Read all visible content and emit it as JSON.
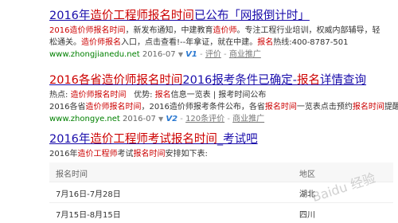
{
  "results": [
    {
      "title": [
        "2016年",
        "造价工程师报名时间",
        "已公布「网报倒计时」"
      ],
      "desc1": [
        "2016造价师报名时间",
        "，新发布通知，中建教育",
        "造价师",
        "。专注工程行业培训，权威内部辅导，轻"
      ],
      "desc2": [
        "松通关。",
        "造价师报名",
        "入口，点击查看!--年拿证，就在中建。",
        "报名",
        "热线:400-8787-501"
      ],
      "url": "www.zhongjianedu.net",
      "date": "2016-07",
      "badge": "V1",
      "eval": "评价",
      "promo": "商业推广"
    },
    {
      "title": [
        "2016各省造价师报名时间",
        "2016",
        "报考条件已确定-",
        "报名",
        "详情查询"
      ],
      "desc1": [
        "热点: ",
        "造价师报名时间",
        "   优势: ",
        "报名",
        "信息一览表 | 报考时间公布"
      ],
      "desc2": [
        "2016各省",
        "造价师报名时间",
        "，2016造价师报考条件公布，各省",
        "报名时间",
        "一览表点击预约",
        "报名时间",
        "提醒."
      ],
      "url": "www.zhongye.net",
      "date": "2016-07",
      "badge": "V2",
      "eval": "120条评价",
      "promo": "商业推广"
    },
    {
      "title": [
        "2016年",
        "造价工程师考试报名时间",
        "_考试吧"
      ],
      "desc1": [
        "2016年",
        "造价工程师",
        "考试",
        "报名时间",
        "安排如下表:"
      ]
    }
  ],
  "table": {
    "headers": [
      "报名时间",
      "地区"
    ],
    "rows": [
      [
        "7月16日-7月28日",
        "湖北"
      ],
      [
        "7月15日-8月15日",
        "四川"
      ]
    ]
  },
  "watermark": "Baidu 经验",
  "colors": {
    "link": "#1a0dab",
    "highlight": "#cc0000",
    "url": "#008000"
  }
}
